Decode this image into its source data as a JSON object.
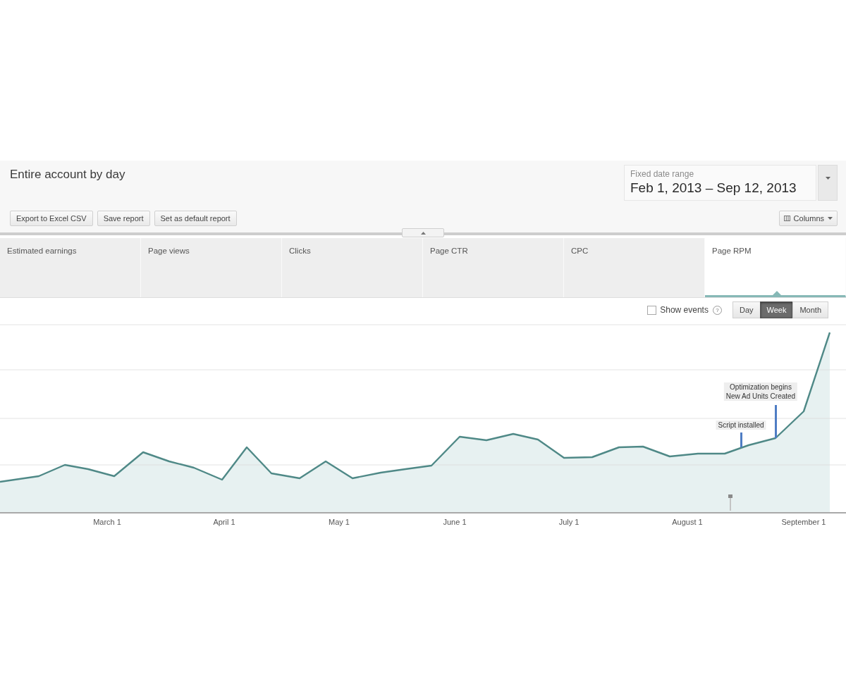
{
  "report": {
    "title": "Entire account by day",
    "date_range": {
      "label": "Fixed date range",
      "value": "Feb 1, 2013 – Sep 12, 2013"
    },
    "actions": [
      "Export to Excel CSV",
      "Save report",
      "Set as default report"
    ],
    "columns_button": "Columns"
  },
  "metric_tabs": [
    {
      "label": "Estimated earnings",
      "selected": false
    },
    {
      "label": "Page views",
      "selected": false
    },
    {
      "label": "Clicks",
      "selected": false
    },
    {
      "label": "Page CTR",
      "selected": false
    },
    {
      "label": "CPC",
      "selected": false
    },
    {
      "label": "Page RPM",
      "selected": true
    }
  ],
  "chart_controls": {
    "show_events": {
      "label": "Show events",
      "checked": false
    },
    "help": "?",
    "granularity": [
      {
        "label": "Day",
        "selected": false
      },
      {
        "label": "Week",
        "selected": true
      },
      {
        "label": "Month",
        "selected": false
      }
    ]
  },
  "chart": {
    "x_labels": [
      "March 1",
      "April 1",
      "May 1",
      "June 1",
      "July 1",
      "August 1",
      "September 1"
    ],
    "events": [
      {
        "lines": [
          "Optimization begins",
          "New Ad Units Created"
        ]
      },
      {
        "lines": [
          "Script installed"
        ]
      }
    ]
  }
}
